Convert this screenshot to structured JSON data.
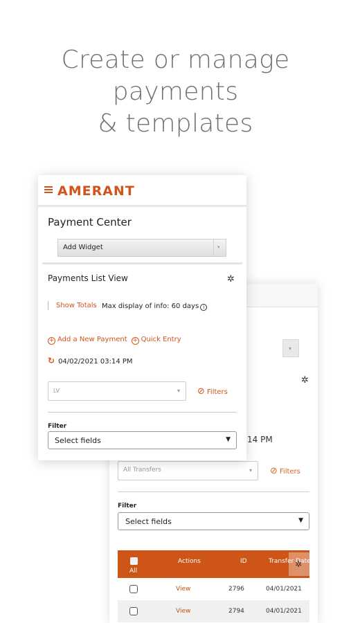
{
  "headline": [
    "Create or manage",
    "payments",
    "& templates"
  ],
  "brand": {
    "name": "AMERANT",
    "accent": "#d2541b"
  },
  "front": {
    "menu_icon": "hamburger-icon",
    "title": "Payment Center",
    "add_widget": {
      "value": "Add Widget"
    },
    "widget_title": "Payments List View",
    "settings_icon": "gear-icon",
    "show_totals": "Show Totals",
    "max_display": "Max display of info: 60 days",
    "add_payment": "Add a New Payment",
    "quick_entry": "Quick Entry",
    "refresh_time": "04/02/2021 03:14 PM",
    "view_select": {
      "value": "LV"
    },
    "filters_label": "Filters",
    "filter_heading": "Filter",
    "fields_select": {
      "value": "Select fields"
    }
  },
  "back": {
    "time_partial": ":14 PM",
    "view_select": {
      "value": "All Transfers"
    },
    "filters_label": "Filters",
    "filter_heading": "Filter",
    "fields_select": {
      "value": "Select fields"
    },
    "table": {
      "headers": {
        "all": "All",
        "actions": "Actions",
        "id": "ID",
        "date": "Transfer Date"
      },
      "rows": [
        {
          "action": "View",
          "id": "2796",
          "date": "04/01/2021"
        },
        {
          "action": "View",
          "id": "2794",
          "date": "04/01/2021"
        }
      ]
    }
  }
}
